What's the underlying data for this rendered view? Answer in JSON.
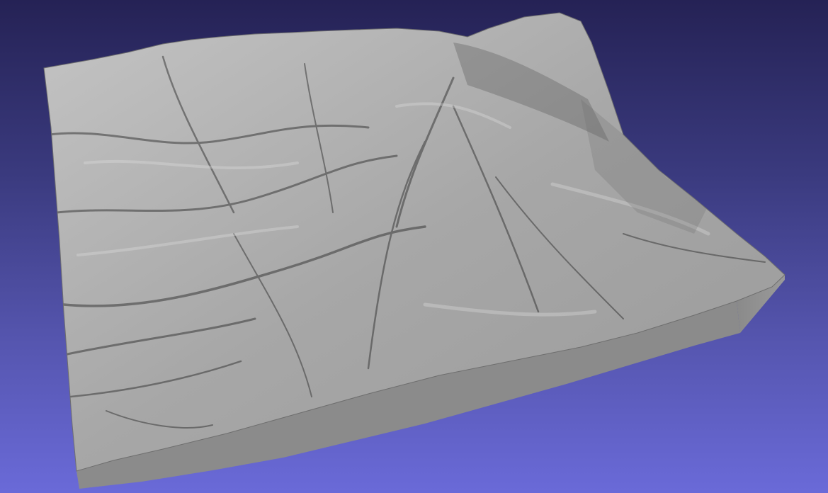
{
  "viewer": {
    "background_top": "#252255",
    "background_bottom": "#6a6ad8",
    "model": {
      "name": "terrain-mesh",
      "surface_color": "#a9a9a9",
      "side_color": "#8c8c8c",
      "shading_color": "#3c3c3c"
    }
  }
}
